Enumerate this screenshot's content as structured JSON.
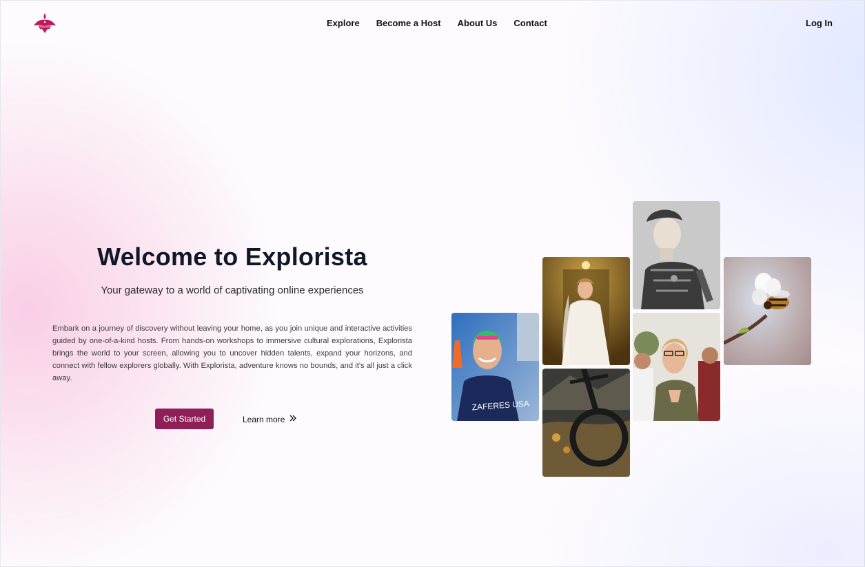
{
  "header": {
    "logo_icon": "bird-logo-icon",
    "nav": [
      "Explore",
      "Become a Host",
      "About Us",
      "Contact"
    ],
    "login": "Log In"
  },
  "hero": {
    "title": "Welcome to Explorista",
    "subtitle": "Your gateway to a world of captivating online experiences",
    "description": "Embark on a journey of discovery without leaving your home, as you join unique and interactive activities guided by one-of-a-kind hosts. From hands-on workshops to immersive cultural explorations, Explorista brings the world to your screen, allowing you to uncover hidden talents, expand your horizons, and connect with fellow explorers globally. With Explorista, adventure knows no bounds, and it's all just a click away.",
    "primary_button": "Get Started",
    "secondary_link": "Learn more",
    "secondary_icon": "chevrons-right-icon"
  },
  "gallery": {
    "images": [
      "swimmer-photo",
      "bride-photo",
      "robot-photo",
      "bee-flower-photo",
      "mountain-bike-photo",
      "concert-crowd-photo"
    ],
    "swimmer_caption": "ZAFERES USA"
  },
  "colors": {
    "brand": "#8e1f57",
    "logo": "#c2185b",
    "text": "#101828"
  }
}
